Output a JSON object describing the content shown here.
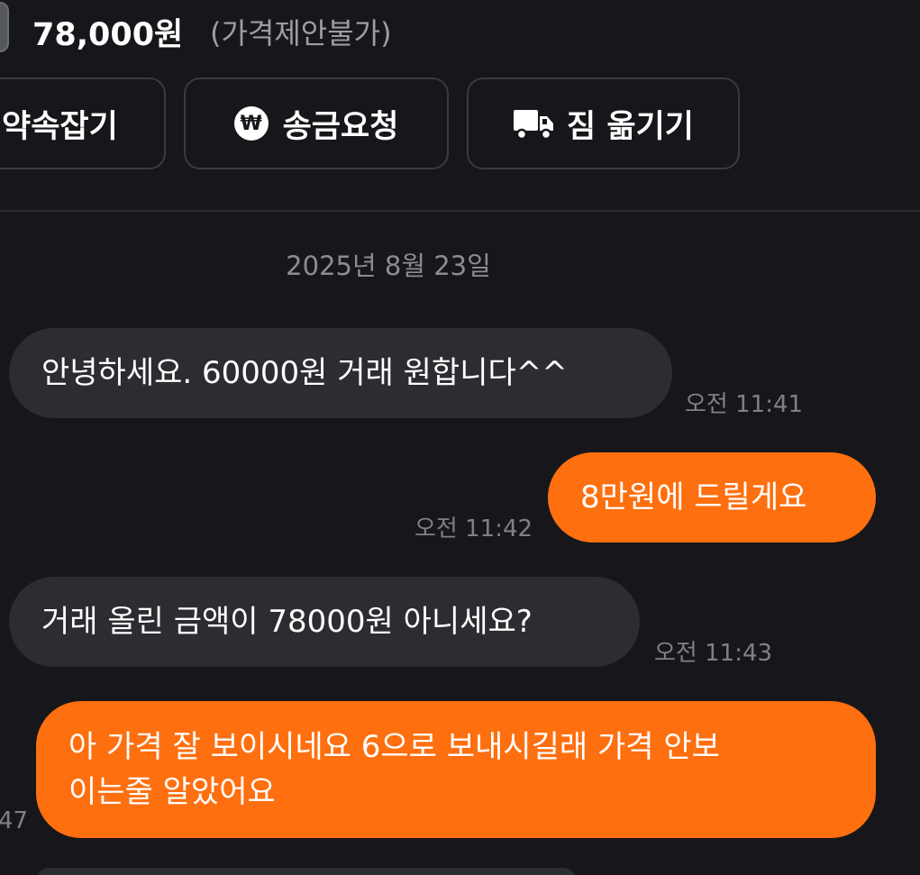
{
  "header": {
    "price": "78,000원",
    "price_note": "(가격제안불가)"
  },
  "actions": [
    {
      "label": "약속잡기",
      "icon": "calendar-icon"
    },
    {
      "label": "송금요청",
      "icon": "won-icon",
      "icon_glyph": "₩"
    },
    {
      "label": "짐 옮기기",
      "icon": "truck-icon"
    }
  ],
  "chat": {
    "date": "2025년 8월 23일",
    "messages": [
      {
        "from": "other",
        "text": "안녕하세요. 60000원 거래 원합니다^^",
        "time": "오전 11:41"
      },
      {
        "from": "me",
        "text": "8만원에 드릴게요",
        "time": "오전 11:42"
      },
      {
        "from": "other",
        "text": "거래 올린 금액이 78000원 아니세요?",
        "time": "오전 11:43"
      },
      {
        "from": "me",
        "text": "아 가격 잘 보이시네요 6으로 보내시길래 가격 안보이는줄 알았어요",
        "text_line1": "아 가격 잘 보이시네요 6으로 보내시길래 가격 안보",
        "text_line2": "이는줄 알았어요",
        "time_partial": "47"
      }
    ]
  },
  "colors": {
    "background": "#17171b",
    "incoming_bubble": "#2c2d31",
    "outgoing_bubble": "#fe6f0f",
    "text_primary": "#ffffff",
    "text_secondary": "#8a8d92"
  }
}
